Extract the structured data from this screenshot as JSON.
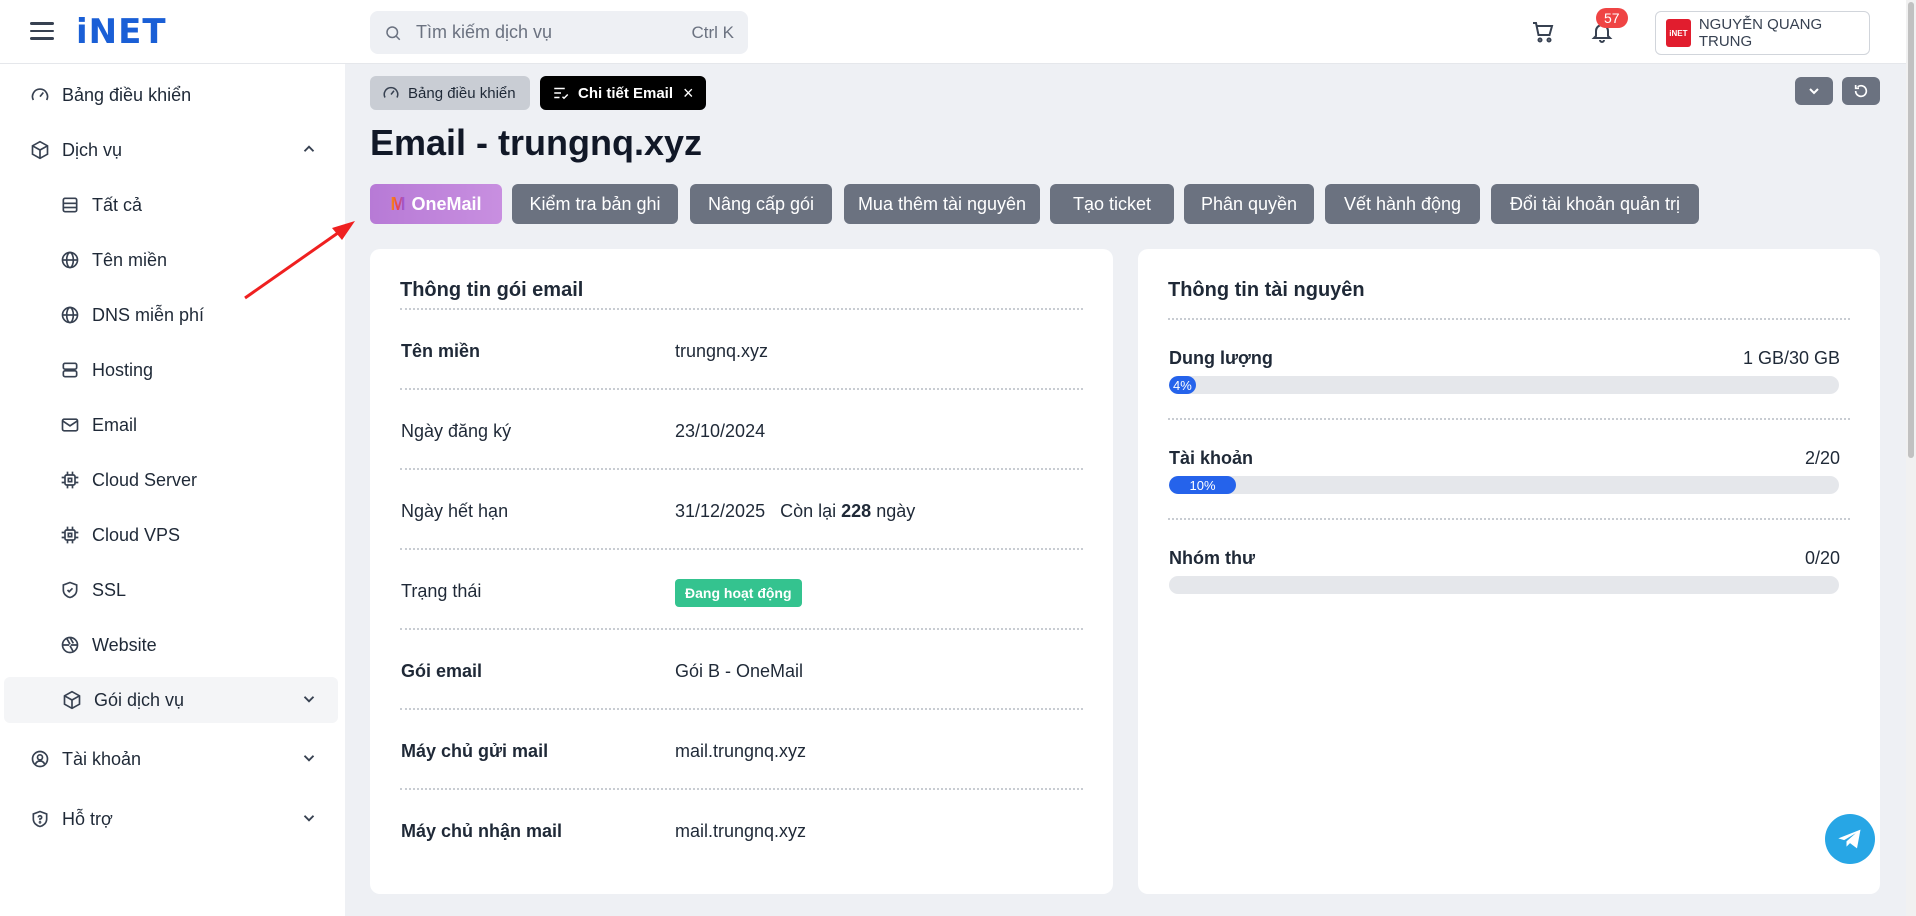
{
  "header": {
    "logo": "iNET",
    "search_placeholder": "Tìm kiếm dịch vụ",
    "search_shortcut": "Ctrl K",
    "notification_count": "57",
    "user_name": "NGUYỄN QUANG TRUNG",
    "user_avatar_text": "iNET"
  },
  "sidebar": {
    "dashboard": "Bảng điều khiển",
    "services": "Dịch vụ",
    "sub_items": [
      "Tất cả",
      "Tên miền",
      "DNS miễn phí",
      "Hosting",
      "Email",
      "Cloud Server",
      "Cloud VPS",
      "SSL",
      "Website"
    ],
    "packages": "Gói dịch vụ",
    "account": "Tài khoản",
    "support": "Hỗ trợ"
  },
  "tabs": {
    "home": "Bảng điều khiển",
    "current": "Chi tiết Email",
    "close": "×"
  },
  "page_title": "Email - trungnq.xyz",
  "actions": {
    "onemail_icon": "M",
    "onemail": "OneMail",
    "check_records": "Kiểm tra bản ghi",
    "upgrade": "Nâng cấp gói",
    "buy_resources": "Mua thêm tài nguyên",
    "create_ticket": "Tạo ticket",
    "permissions": "Phân quyền",
    "action_log": "Vết hành động",
    "change_admin": "Đổi tài khoản quản trị"
  },
  "package_info": {
    "title": "Thông tin gói email",
    "domain_label": "Tên miền",
    "domain_value": "trungnq.xyz",
    "reg_label": "Ngày đăng ký",
    "reg_value": "23/10/2024",
    "exp_label": "Ngày hết hạn",
    "exp_value": "31/12/2025",
    "remaining_prefix": "Còn lại",
    "remaining_days": "228",
    "remaining_suffix": "ngày",
    "status_label": "Trạng thái",
    "status_value": "Đang hoạt động",
    "plan_label": "Gói email",
    "plan_value": "Gói B - OneMail",
    "smtp_label": "Máy chủ gửi mail",
    "smtp_value": "mail.trungnq.xyz",
    "imap_label": "Máy chủ nhận mail",
    "imap_value": "mail.trungnq.xyz"
  },
  "resource_info": {
    "title": "Thông tin tài nguyên",
    "storage_label": "Dung lượng",
    "storage_value": "1 GB/30 GB",
    "storage_pct_text": "4%",
    "storage_pct": 4,
    "accounts_label": "Tài khoản",
    "accounts_value": "2/20",
    "accounts_pct_text": "10%",
    "accounts_pct": 10,
    "groups_label": "Nhóm thư",
    "groups_value": "0/20",
    "groups_pct": 0
  },
  "colors": {
    "primary": "#2563eb",
    "status_green": "#34c38f",
    "button_gray": "#6b7280",
    "badge_red": "#ef4444"
  }
}
